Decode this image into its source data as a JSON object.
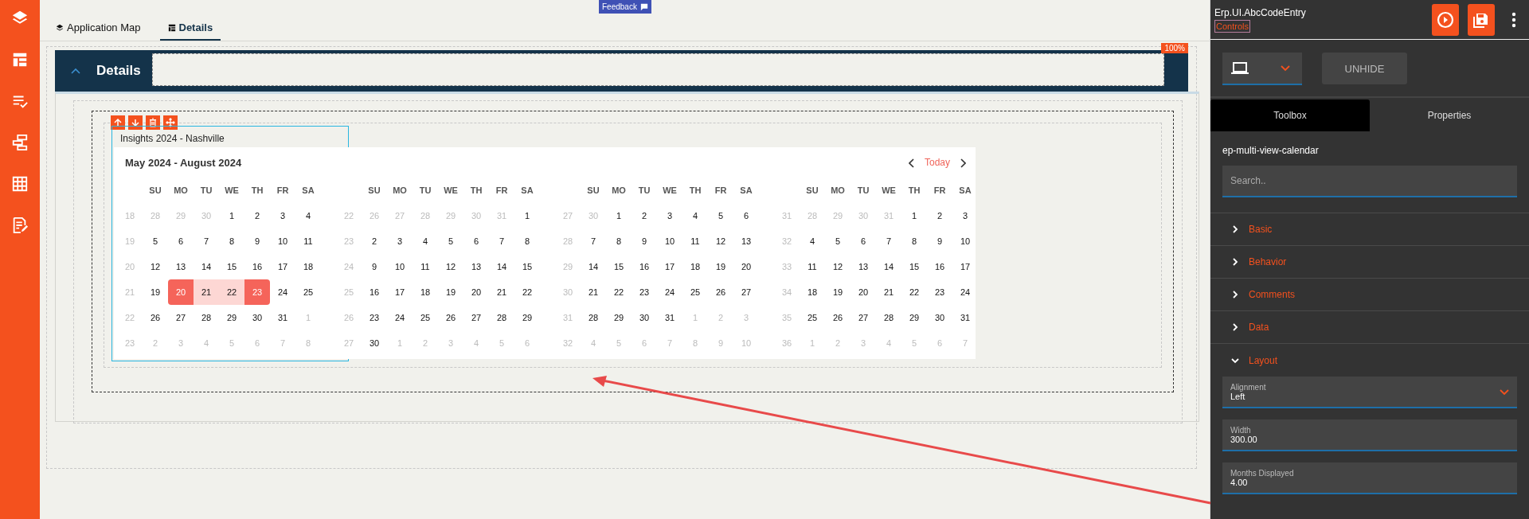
{
  "feedback": {
    "label": "Feedback"
  },
  "tabs": [
    {
      "label": "Application Map",
      "selected": false
    },
    {
      "label": "Details",
      "selected": true
    }
  ],
  "panel": {
    "title": "Details",
    "expanded": true,
    "zoom_badge": "100%"
  },
  "component": {
    "label": "Insights 2024 - Nashville"
  },
  "calendar": {
    "title": "May 2024 - August 2024",
    "today_label": "Today",
    "months": [
      {
        "weekdays": [
          "SU",
          "MO",
          "TU",
          "WE",
          "TH",
          "FR",
          "SA"
        ],
        "weeks": [
          {
            "week": "18",
            "days": [
              "28",
              "29",
              "30",
              "1",
              "2",
              "3",
              "4"
            ],
            "outside": [
              true,
              true,
              true,
              false,
              false,
              false,
              false
            ],
            "in_range": [
              false,
              false,
              false,
              false,
              false,
              false,
              false
            ],
            "endpoint": [
              false,
              false,
              false,
              false,
              false,
              false,
              false
            ]
          },
          {
            "week": "19",
            "days": [
              "5",
              "6",
              "7",
              "8",
              "9",
              "10",
              "11"
            ],
            "outside": [
              false,
              false,
              false,
              false,
              false,
              false,
              false
            ],
            "in_range": [
              false,
              false,
              false,
              false,
              false,
              false,
              false
            ],
            "endpoint": [
              false,
              false,
              false,
              false,
              false,
              false,
              false
            ]
          },
          {
            "week": "20",
            "days": [
              "12",
              "13",
              "14",
              "15",
              "16",
              "17",
              "18"
            ],
            "outside": [
              false,
              false,
              false,
              false,
              false,
              false,
              false
            ],
            "in_range": [
              false,
              false,
              false,
              false,
              false,
              false,
              false
            ],
            "endpoint": [
              false,
              false,
              false,
              false,
              false,
              false,
              false
            ]
          },
          {
            "week": "21",
            "days": [
              "19",
              "20",
              "21",
              "22",
              "23",
              "24",
              "25"
            ],
            "outside": [
              false,
              false,
              false,
              false,
              false,
              false,
              false
            ],
            "in_range": [
              false,
              true,
              true,
              true,
              true,
              false,
              false
            ],
            "endpoint": [
              false,
              true,
              false,
              false,
              true,
              false,
              false
            ]
          },
          {
            "week": "22",
            "days": [
              "26",
              "27",
              "28",
              "29",
              "30",
              "31",
              "1"
            ],
            "outside": [
              false,
              false,
              false,
              false,
              false,
              false,
              true
            ],
            "in_range": [
              false,
              false,
              false,
              false,
              false,
              false,
              false
            ],
            "endpoint": [
              false,
              false,
              false,
              false,
              false,
              false,
              false
            ]
          },
          {
            "week": "23",
            "days": [
              "2",
              "3",
              "4",
              "5",
              "6",
              "7",
              "8"
            ],
            "outside": [
              true,
              true,
              true,
              true,
              true,
              true,
              true
            ],
            "in_range": [
              false,
              false,
              false,
              false,
              false,
              false,
              false
            ],
            "endpoint": [
              false,
              false,
              false,
              false,
              false,
              false,
              false
            ]
          }
        ]
      },
      {
        "weekdays": [
          "SU",
          "MO",
          "TU",
          "WE",
          "TH",
          "FR",
          "SA"
        ],
        "weeks": [
          {
            "week": "22",
            "days": [
              "26",
              "27",
              "28",
              "29",
              "30",
              "31",
              "1"
            ],
            "outside": [
              true,
              true,
              true,
              true,
              true,
              true,
              false
            ],
            "in_range": [
              false,
              false,
              false,
              false,
              false,
              false,
              false
            ],
            "endpoint": [
              false,
              false,
              false,
              false,
              false,
              false,
              false
            ]
          },
          {
            "week": "23",
            "days": [
              "2",
              "3",
              "4",
              "5",
              "6",
              "7",
              "8"
            ],
            "outside": [
              false,
              false,
              false,
              false,
              false,
              false,
              false
            ],
            "in_range": [
              false,
              false,
              false,
              false,
              false,
              false,
              false
            ],
            "endpoint": [
              false,
              false,
              false,
              false,
              false,
              false,
              false
            ]
          },
          {
            "week": "24",
            "days": [
              "9",
              "10",
              "11",
              "12",
              "13",
              "14",
              "15"
            ],
            "outside": [
              false,
              false,
              false,
              false,
              false,
              false,
              false
            ],
            "in_range": [
              false,
              false,
              false,
              false,
              false,
              false,
              false
            ],
            "endpoint": [
              false,
              false,
              false,
              false,
              false,
              false,
              false
            ]
          },
          {
            "week": "25",
            "days": [
              "16",
              "17",
              "18",
              "19",
              "20",
              "21",
              "22"
            ],
            "outside": [
              false,
              false,
              false,
              false,
              false,
              false,
              false
            ],
            "in_range": [
              false,
              false,
              false,
              false,
              false,
              false,
              false
            ],
            "endpoint": [
              false,
              false,
              false,
              false,
              false,
              false,
              false
            ]
          },
          {
            "week": "26",
            "days": [
              "23",
              "24",
              "25",
              "26",
              "27",
              "28",
              "29"
            ],
            "outside": [
              false,
              false,
              false,
              false,
              false,
              false,
              false
            ],
            "in_range": [
              false,
              false,
              false,
              false,
              false,
              false,
              false
            ],
            "endpoint": [
              false,
              false,
              false,
              false,
              false,
              false,
              false
            ]
          },
          {
            "week": "27",
            "days": [
              "30",
              "1",
              "2",
              "3",
              "4",
              "5",
              "6"
            ],
            "outside": [
              false,
              true,
              true,
              true,
              true,
              true,
              true
            ],
            "in_range": [
              false,
              false,
              false,
              false,
              false,
              false,
              false
            ],
            "endpoint": [
              false,
              false,
              false,
              false,
              false,
              false,
              false
            ]
          }
        ]
      },
      {
        "weekdays": [
          "SU",
          "MO",
          "TU",
          "WE",
          "TH",
          "FR",
          "SA"
        ],
        "weeks": [
          {
            "week": "27",
            "days": [
              "30",
              "1",
              "2",
              "3",
              "4",
              "5",
              "6"
            ],
            "outside": [
              true,
              false,
              false,
              false,
              false,
              false,
              false
            ],
            "in_range": [
              false,
              false,
              false,
              false,
              false,
              false,
              false
            ],
            "endpoint": [
              false,
              false,
              false,
              false,
              false,
              false,
              false
            ]
          },
          {
            "week": "28",
            "days": [
              "7",
              "8",
              "9",
              "10",
              "11",
              "12",
              "13"
            ],
            "outside": [
              false,
              false,
              false,
              false,
              false,
              false,
              false
            ],
            "in_range": [
              false,
              false,
              false,
              false,
              false,
              false,
              false
            ],
            "endpoint": [
              false,
              false,
              false,
              false,
              false,
              false,
              false
            ]
          },
          {
            "week": "29",
            "days": [
              "14",
              "15",
              "16",
              "17",
              "18",
              "19",
              "20"
            ],
            "outside": [
              false,
              false,
              false,
              false,
              false,
              false,
              false
            ],
            "in_range": [
              false,
              false,
              false,
              false,
              false,
              false,
              false
            ],
            "endpoint": [
              false,
              false,
              false,
              false,
              false,
              false,
              false
            ]
          },
          {
            "week": "30",
            "days": [
              "21",
              "22",
              "23",
              "24",
              "25",
              "26",
              "27"
            ],
            "outside": [
              false,
              false,
              false,
              false,
              false,
              false,
              false
            ],
            "in_range": [
              false,
              false,
              false,
              false,
              false,
              false,
              false
            ],
            "endpoint": [
              false,
              false,
              false,
              false,
              false,
              false,
              false
            ]
          },
          {
            "week": "31",
            "days": [
              "28",
              "29",
              "30",
              "31",
              "1",
              "2",
              "3"
            ],
            "outside": [
              false,
              false,
              false,
              false,
              true,
              true,
              true
            ],
            "in_range": [
              false,
              false,
              false,
              false,
              false,
              false,
              false
            ],
            "endpoint": [
              false,
              false,
              false,
              false,
              false,
              false,
              false
            ]
          },
          {
            "week": "32",
            "days": [
              "4",
              "5",
              "6",
              "7",
              "8",
              "9",
              "10"
            ],
            "outside": [
              true,
              true,
              true,
              true,
              true,
              true,
              true
            ],
            "in_range": [
              false,
              false,
              false,
              false,
              false,
              false,
              false
            ],
            "endpoint": [
              false,
              false,
              false,
              false,
              false,
              false,
              false
            ]
          }
        ]
      },
      {
        "weekdays": [
          "SU",
          "MO",
          "TU",
          "WE",
          "TH",
          "FR",
          "SA"
        ],
        "weeks": [
          {
            "week": "31",
            "days": [
              "28",
              "29",
              "30",
              "31",
              "1",
              "2",
              "3"
            ],
            "outside": [
              true,
              true,
              true,
              true,
              false,
              false,
              false
            ],
            "in_range": [
              false,
              false,
              false,
              false,
              false,
              false,
              false
            ],
            "endpoint": [
              false,
              false,
              false,
              false,
              false,
              false,
              false
            ]
          },
          {
            "week": "32",
            "days": [
              "4",
              "5",
              "6",
              "7",
              "8",
              "9",
              "10"
            ],
            "outside": [
              false,
              false,
              false,
              false,
              false,
              false,
              false
            ],
            "in_range": [
              false,
              false,
              false,
              false,
              false,
              false,
              false
            ],
            "endpoint": [
              false,
              false,
              false,
              false,
              false,
              false,
              false
            ]
          },
          {
            "week": "33",
            "days": [
              "11",
              "12",
              "13",
              "14",
              "15",
              "16",
              "17"
            ],
            "outside": [
              false,
              false,
              false,
              false,
              false,
              false,
              false
            ],
            "in_range": [
              false,
              false,
              false,
              false,
              false,
              false,
              false
            ],
            "endpoint": [
              false,
              false,
              false,
              false,
              false,
              false,
              false
            ]
          },
          {
            "week": "34",
            "days": [
              "18",
              "19",
              "20",
              "21",
              "22",
              "23",
              "24"
            ],
            "outside": [
              false,
              false,
              false,
              false,
              false,
              false,
              false
            ],
            "in_range": [
              false,
              false,
              false,
              false,
              false,
              false,
              false
            ],
            "endpoint": [
              false,
              false,
              false,
              false,
              false,
              false,
              false
            ]
          },
          {
            "week": "35",
            "days": [
              "25",
              "26",
              "27",
              "28",
              "29",
              "30",
              "31"
            ],
            "outside": [
              false,
              false,
              false,
              false,
              false,
              false,
              false
            ],
            "in_range": [
              false,
              false,
              false,
              false,
              false,
              false,
              false
            ],
            "endpoint": [
              false,
              false,
              false,
              false,
              false,
              false,
              false
            ]
          },
          {
            "week": "36",
            "days": [
              "1",
              "2",
              "3",
              "4",
              "5",
              "6",
              "7"
            ],
            "outside": [
              true,
              true,
              true,
              true,
              true,
              true,
              true
            ],
            "in_range": [
              false,
              false,
              false,
              false,
              false,
              false,
              false
            ],
            "endpoint": [
              false,
              false,
              false,
              false,
              false,
              false,
              false
            ]
          }
        ]
      }
    ]
  },
  "right_panel": {
    "app_name": "Erp.UI.AbcCodeEntry",
    "breadcrumb": "Controls",
    "unhide_label": "UNHIDE",
    "tabs": [
      {
        "label": "Toolbox",
        "selected": true
      },
      {
        "label": "Properties",
        "selected": false
      }
    ],
    "control_name": "ep-multi-view-calendar",
    "search": {
      "placeholder": "Search.."
    },
    "sections": [
      {
        "label": "Basic",
        "expanded": false
      },
      {
        "label": "Behavior",
        "expanded": false
      },
      {
        "label": "Comments",
        "expanded": false
      },
      {
        "label": "Data",
        "expanded": false
      },
      {
        "label": "Layout",
        "expanded": true
      }
    ],
    "fields": [
      {
        "kind": "select",
        "label": "Alignment",
        "value": "Left"
      },
      {
        "kind": "number",
        "label": "Width",
        "value": "300.00"
      },
      {
        "kind": "number",
        "label": "Months Displayed",
        "value": "4.00"
      }
    ]
  }
}
